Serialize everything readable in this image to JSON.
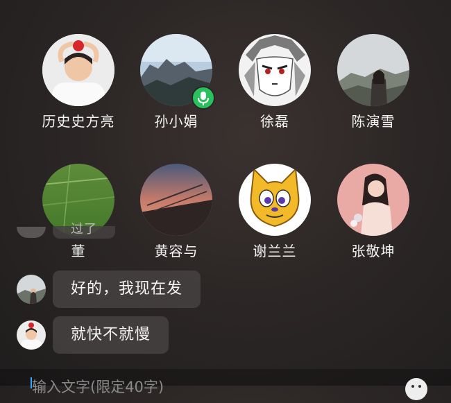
{
  "members": [
    {
      "name": "历史史方亮",
      "avatar": "boy-apple-avatar"
    },
    {
      "name": "孙小娟",
      "avatar": "mountain-avatar",
      "badge": "mic-icon"
    },
    {
      "name": "徐磊",
      "avatar": "anime-avatar"
    },
    {
      "name": "陈演雪",
      "avatar": "woman-mountain-avatar"
    },
    {
      "name": "董",
      "avatar": "grass-field-avatar"
    },
    {
      "name": "黄容与",
      "avatar": "sunset-avatar"
    },
    {
      "name": "谢兰兰",
      "avatar": "cartoon-cat-avatar"
    },
    {
      "name": "张敬坤",
      "avatar": "woman-portrait-avatar"
    }
  ],
  "chat": {
    "partial_text": "过了",
    "messages": [
      {
        "text": "好的，我现在发",
        "avatar": "woman-mountain-avatar"
      },
      {
        "text": "就快不就慢",
        "avatar": "boy-apple-avatar"
      }
    ]
  },
  "input": {
    "placeholder": "输入文字(限定40字)"
  },
  "colors": {
    "mic_badge": "#29c15e",
    "cursor": "#39a7ff"
  }
}
